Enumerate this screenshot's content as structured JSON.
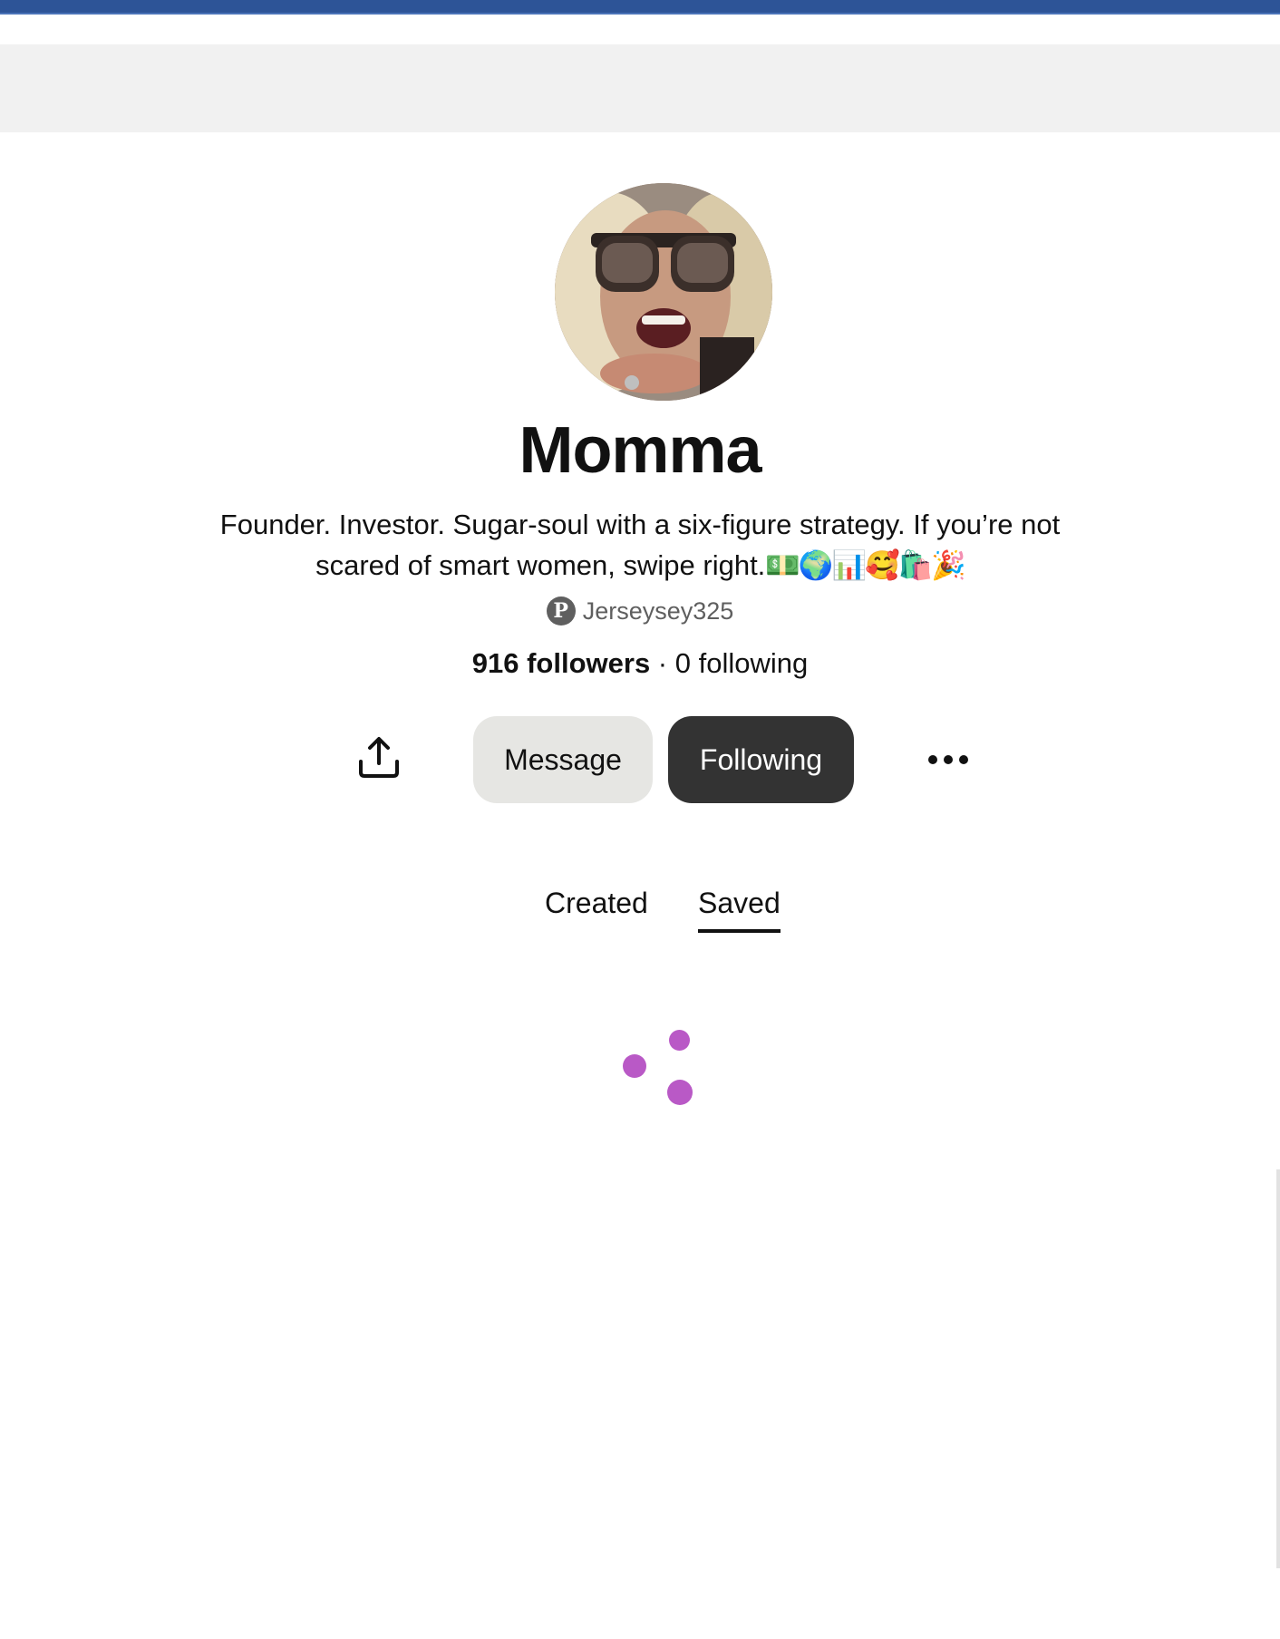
{
  "profile": {
    "name": "Momma",
    "bio_text": "Founder. Investor. Sugar-soul with a six-figure strategy. If you’re not scared of smart women, swipe right.",
    "bio_emojis": "💵🌍📊🥰🛍️🎉",
    "username": "Jerseysey325",
    "followers": "916 followers",
    "separator": " · ",
    "following": "0 following"
  },
  "actions": {
    "share_icon": "share-icon",
    "message_label": "Message",
    "following_label": "Following",
    "more_icon": "more-icon"
  },
  "tabs": [
    {
      "label": "Created",
      "active": false
    },
    {
      "label": "Saved",
      "active": true
    }
  ],
  "colors": {
    "top_bar": "#2d5497",
    "following_button": "#333333",
    "message_button": "#e6e6e3",
    "spinner": "#b959c6"
  }
}
